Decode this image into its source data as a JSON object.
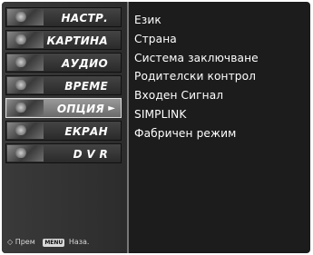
{
  "menu": {
    "items": [
      {
        "label": "НАСТР.",
        "icon": "setup-thumbnail-icon",
        "selected": false
      },
      {
        "label": "КАРТИНА",
        "icon": "picture-thumbnail-icon",
        "selected": false
      },
      {
        "label": "АУДИО",
        "icon": "audio-thumbnail-icon",
        "selected": false
      },
      {
        "label": "ВРЕМЕ",
        "icon": "time-thumbnail-icon",
        "selected": false
      },
      {
        "label": "ОПЦИЯ",
        "icon": "option-thumbnail-icon",
        "selected": true
      },
      {
        "label": "ЕКРАН",
        "icon": "screen-thumbnail-icon",
        "selected": false
      },
      {
        "label": "D V R",
        "icon": "dvr-thumbnail-icon",
        "selected": false
      }
    ],
    "selected_arrow": "►"
  },
  "submenu": {
    "items": [
      "Език",
      "Страна",
      "Система заключване",
      "Родителски контрол",
      "Входен Сигнал",
      "SIMPLINK",
      "Фабричен режим"
    ]
  },
  "hint": {
    "nav_icon": "◇",
    "nav_label": "Прем",
    "menu_key": "MENU",
    "menu_label": "Наза."
  },
  "colors": {
    "background": "#1c1c1c",
    "text": "#ffffff",
    "selected_item": "#8a8a8a"
  }
}
